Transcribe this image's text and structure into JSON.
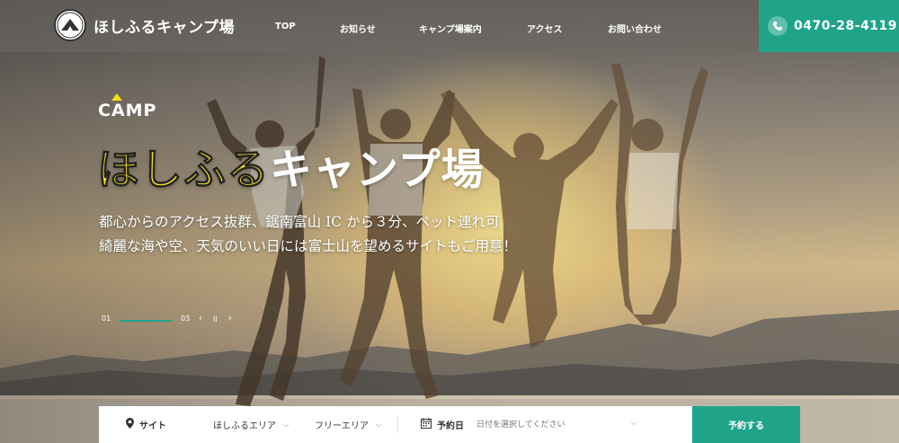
{
  "header": {
    "logo_text": "ほしふるキャンプ場",
    "nav": [
      "TOP",
      "お知らせ",
      "キャンプ場案内",
      "アクセス",
      "お問い合わせ"
    ],
    "phone": "0470-28-4119"
  },
  "hero": {
    "eyebrow": "CAMP",
    "title_yellow": "ほしふる",
    "title_white": "キャンプ場",
    "subtitle_line1": "都心からのアクセス抜群、鋸南富山 IC から３分、ペット連れ可",
    "subtitle_line2": "綺麗な海や空、天気のいい日には富士山を望めるサイトもご用意！"
  },
  "slider": {
    "current": "01",
    "total": "03",
    "prev": "‹",
    "pause": "II",
    "next": "›"
  },
  "search": {
    "site_label": "サイト",
    "area_select": "ほしふるエリア",
    "area_free": "フリーエリア",
    "date_label": "予約日",
    "date_placeholder": "日付を選択してください",
    "submit": "予約する"
  },
  "colors": {
    "accent": "#1fa48a",
    "title_yellow": "#f9e31a"
  },
  "icons": [
    "phone-icon",
    "location-pin-icon",
    "calendar-icon",
    "chevron-down-icon"
  ]
}
